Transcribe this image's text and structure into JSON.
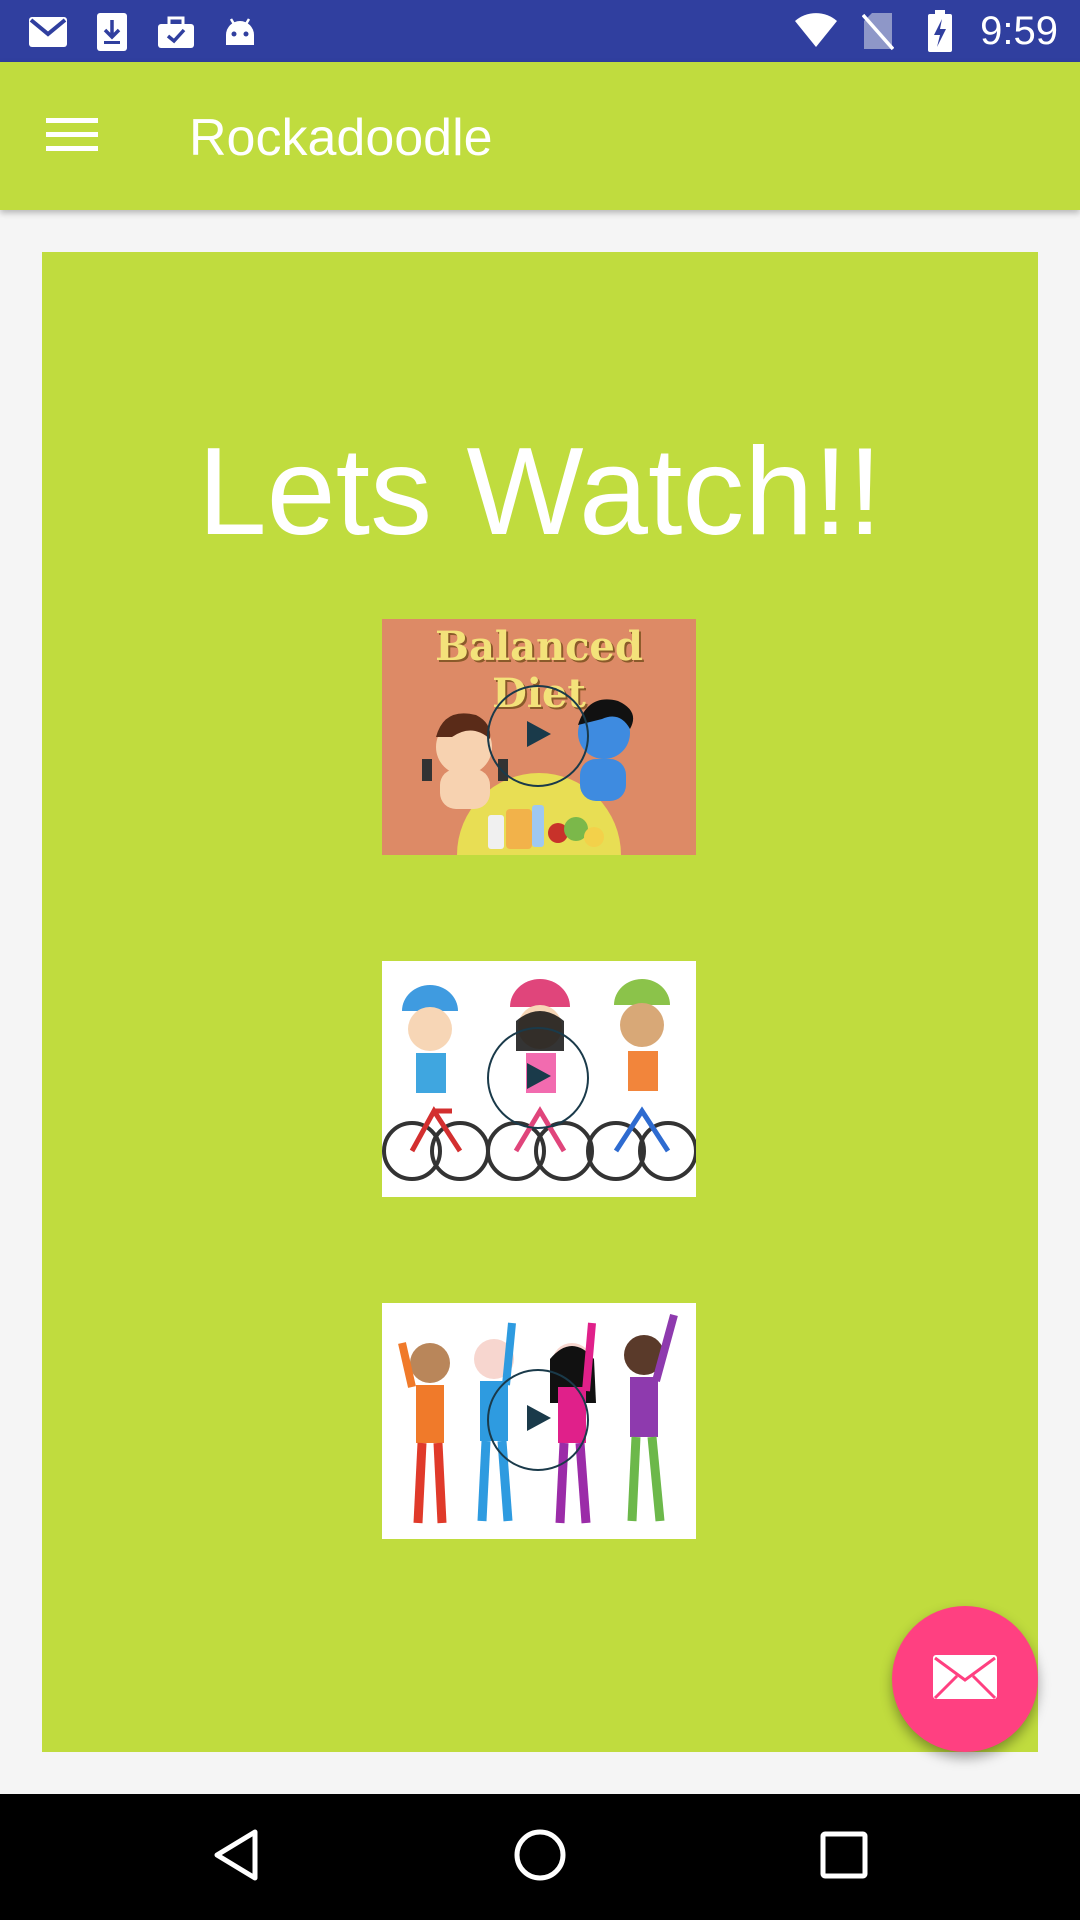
{
  "status_bar": {
    "time": "9:59",
    "left_icons": [
      "gmail-icon",
      "download-icon",
      "briefcase-check-icon",
      "android-icon"
    ],
    "right_icons": [
      "wifi-icon",
      "no-sim-icon",
      "battery-charging-icon"
    ]
  },
  "app_bar": {
    "title": "Rockadoodle",
    "menu_icon": "menu-icon"
  },
  "main": {
    "heading": "Lets Watch!!",
    "videos": [
      {
        "title": "Balanced Diet",
        "thumbnail": "balanced-diet-cartoon"
      },
      {
        "title": "",
        "thumbnail": "kids-on-bicycles-cartoon"
      },
      {
        "title": "",
        "thumbnail": "kids-exercising-cartoon"
      }
    ]
  },
  "fab": {
    "icon": "mail-icon"
  },
  "nav_bar": {
    "icons": [
      "back-icon",
      "home-icon",
      "recents-icon"
    ]
  },
  "colors": {
    "status_bar": "#303F9F",
    "primary": "#C0DC3E",
    "accent": "#FF4081",
    "background": "#F5F5F5"
  }
}
